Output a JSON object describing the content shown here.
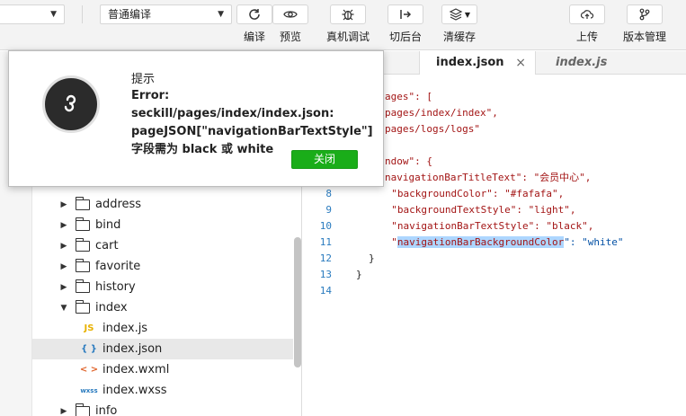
{
  "toolbar": {
    "compile_mode": "普通编译",
    "buttons": {
      "compile": "编译",
      "preview": "预览",
      "device_debug": "真机调试",
      "background": "切后台",
      "clear_cache": "清缓存",
      "upload": "上传",
      "version_mgmt": "版本管理"
    }
  },
  "tabs": [
    {
      "label": "index.json",
      "close": "×"
    },
    {
      "label": "index.js"
    }
  ],
  "tree": [
    {
      "label": "address",
      "type": "folder",
      "expanded": false
    },
    {
      "label": "bind",
      "type": "folder",
      "expanded": false
    },
    {
      "label": "cart",
      "type": "folder",
      "expanded": false
    },
    {
      "label": "favorite",
      "type": "folder",
      "expanded": false
    },
    {
      "label": "history",
      "type": "folder",
      "expanded": false
    },
    {
      "label": "index",
      "type": "folder",
      "expanded": true
    },
    {
      "label": "index.js",
      "type": "file",
      "icon": "JS"
    },
    {
      "label": "index.json",
      "type": "file",
      "icon": "{ }",
      "selected": true
    },
    {
      "label": "index.wxml",
      "type": "file",
      "icon": "< >"
    },
    {
      "label": "index.wxss",
      "type": "file",
      "icon": "wxss"
    },
    {
      "label": "info",
      "type": "folder",
      "expanded": false
    }
  ],
  "code_lines": [
    {
      "n": "",
      "text": "ages\": ["
    },
    {
      "n": "",
      "text": "pages/index/index\","
    },
    {
      "n": "",
      "text": "pages/logs/logs\""
    },
    {
      "n": "",
      "text": ""
    },
    {
      "n": "",
      "text": "ndow\": {"
    },
    {
      "n": "",
      "text": "navigationBarTitleText\": \"会员中心\","
    },
    {
      "n": "8",
      "text": "  \"backgroundColor\": \"#fafafa\","
    },
    {
      "n": "9",
      "text": "  \"backgroundTextStyle\": \"light\","
    },
    {
      "n": "10",
      "text": "  \"navigationBarTextStyle\": \"black\","
    },
    {
      "n": "11",
      "pre": "  \"",
      "hl": "navigationBarBackgroundColor",
      "post": "\": \"white\""
    },
    {
      "n": "12",
      "text": "}"
    },
    {
      "n": "13",
      "text": "}"
    },
    {
      "n": "14",
      "text": ""
    }
  ],
  "modal": {
    "title": "提示",
    "message": "Error: seckill/pages/index/index.json: pageJSON[\"navigationBarTextStyle\"] 字段需为 black 或 white",
    "close_label": "关闭"
  },
  "colors": {
    "accent_green": "#1aad19",
    "line_number": "#2a7bbf",
    "selection": "#add6ff"
  }
}
